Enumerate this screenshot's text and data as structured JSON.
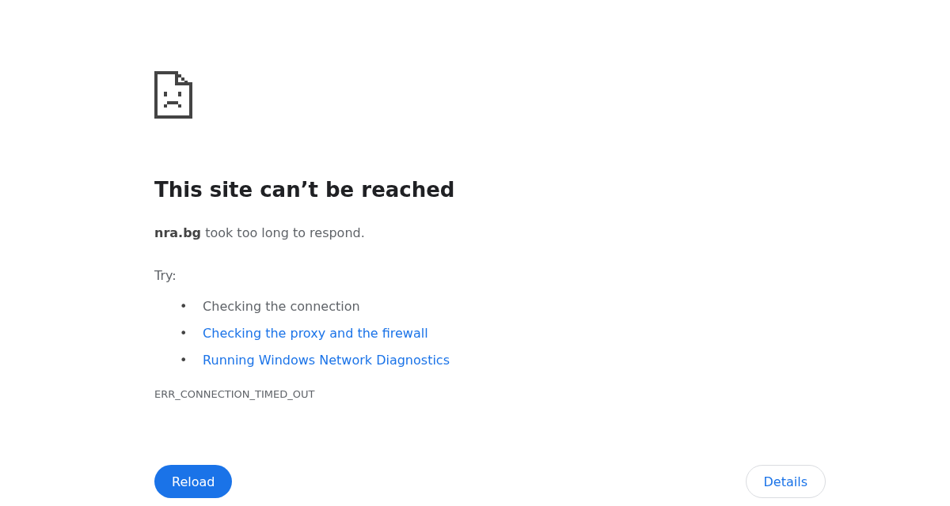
{
  "heading": "This site can’t be reached",
  "message": "**nra.bg** took too long to respond.",
  "try_label": "Try:",
  "suggestions": [
    {
      "bullet": "•",
      "text": "Checking the connection",
      "kind": "text"
    },
    {
      "bullet": "•",
      "text": "Checking the proxy and the firewall",
      "kind": "link"
    },
    {
      "bullet": "•",
      "text": "Running Windows Network Diagnostics",
      "kind": "link"
    }
  ],
  "error_code": "ERR_CONNECTION_TIMED_OUT",
  "buttons": [
    {
      "label": "Reload",
      "kind": "primary"
    },
    {
      "label": "Details",
      "kind": "secondary"
    }
  ]
}
